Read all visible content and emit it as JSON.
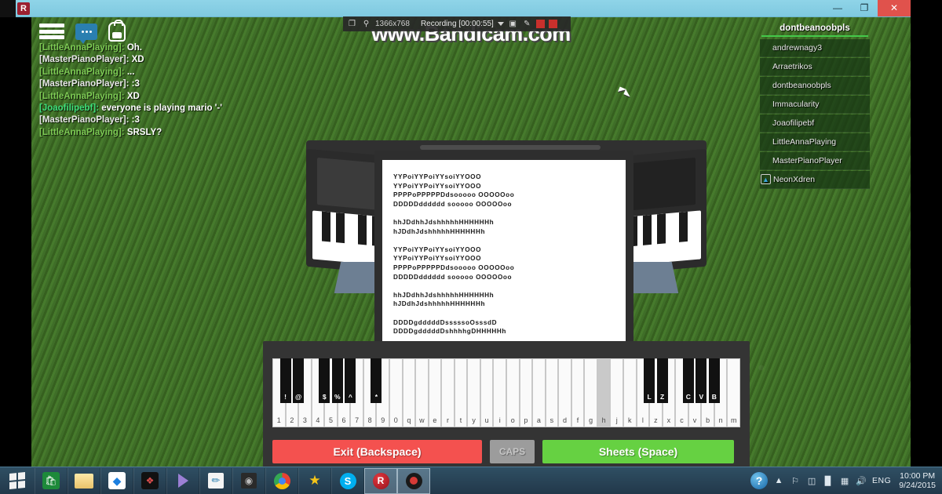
{
  "window": {
    "title": "ROBLOX",
    "minimize_label": "—",
    "maximize_label": "❐",
    "close_label": "✕"
  },
  "bandicam": {
    "watermark": "www.Bandicam.com",
    "resolution": "1366x768",
    "status": "Recording [00:00:55]",
    "window_icon": "window-capture-icon",
    "zoom_icon": "magnifier-icon",
    "dropdown_icon": "chevron-down-icon",
    "camera_icon": "camera-icon",
    "pen_icon": "pen-icon",
    "pause_icon": "pause-record-icon",
    "stop_icon": "stop-record-icon"
  },
  "game_ui": {
    "menu_icon": "hamburger-menu-icon",
    "chat_icon": "chat-bubble-icon",
    "backpack_icon": "backpack-icon"
  },
  "chat": {
    "lines": [
      {
        "name": "[LittleAnnaPlaying]:",
        "message": "Oh.",
        "color": "#7ecb55"
      },
      {
        "name": "[MasterPianoPlayer]:",
        "message": "XD",
        "color": "#e8e8e8"
      },
      {
        "name": "[LittleAnnaPlaying]:",
        "message": "...",
        "color": "#7ecb55"
      },
      {
        "name": "[MasterPianoPlayer]:",
        "message": ":3",
        "color": "#e8e8e8"
      },
      {
        "name": "[LittleAnnaPlaying]:",
        "message": "XD",
        "color": "#7ecb55"
      },
      {
        "name": "[Joaofilipebf]:",
        "message": "everyone is playing mario '-'",
        "color": "#3fe07a"
      },
      {
        "name": "[MasterPianoPlayer]:",
        "message": ":3",
        "color": "#e8e8e8"
      },
      {
        "name": "[LittleAnnaPlaying]:",
        "message": "SRSLY?",
        "color": "#7ecb55"
      }
    ]
  },
  "playerlist": {
    "title": "dontbeanoobpls",
    "accent": "#44c94a",
    "players": [
      {
        "name": "andrewnagy3",
        "badge": false
      },
      {
        "name": "Arraetrikos",
        "badge": false
      },
      {
        "name": "dontbeanoobpls",
        "badge": false
      },
      {
        "name": "Immacularity",
        "badge": false
      },
      {
        "name": "Joaofilipebf",
        "badge": false
      },
      {
        "name": "LittleAnnaPlaying",
        "badge": false
      },
      {
        "name": "MasterPianoPlayer",
        "badge": false
      },
      {
        "name": "NeonXdren",
        "badge": true,
        "badge_icon": "roblox-badge-icon"
      }
    ]
  },
  "sheet": {
    "text": "YYPoiYYPoiYYsoiYYOOO\nYYPoiYYPoiYYsoiYYOOO\nPPPPoPPPPPDdsooooo OOOOOoo\nDDDDDdddddd sooooo OOOOOoo\n\nhhJDdhhJdshhhhhHHHHHHh\nhJDdhJdshhhhhHHHHHHh\n\nYYPoiYYPoiYYsoiYYOOO\nYYPoiYYPoiYYsoiYYOOO\nPPPPoPPPPPDdsooooo OOOOOoo\nDDDDDdddddd sooooo OOOOOoo\n\nhhJDdhhJdshhhhhHHHHHHh\nhJDdhJdshhhhhHHHHHHh\n\nDDDDgdddddDsssssoOsssdD\nDDDDgdddddDshhhhgDHHHHHh\n\nhhJDdhhJdshhhhhHHHHHHh\nhJDdhJdshhhhhHHHHHHh"
  },
  "keyboard": {
    "white_keys": [
      "1",
      "2",
      "3",
      "4",
      "5",
      "6",
      "7",
      "8",
      "9",
      "0",
      "q",
      "w",
      "e",
      "r",
      "t",
      "y",
      "u",
      "i",
      "o",
      "p",
      "a",
      "s",
      "d",
      "f",
      "g",
      "h",
      "j",
      "k",
      "l",
      "z",
      "x",
      "c",
      "v",
      "b",
      "n",
      "m"
    ],
    "highlighted_key": "h",
    "black_keys": [
      "!",
      "@",
      "$",
      "%",
      "^",
      "*",
      "L",
      "Z",
      "C",
      "V",
      "B"
    ],
    "buttons": {
      "exit": "Exit (Backspace)",
      "caps": "CAPS",
      "sheets": "Sheets (Space)"
    },
    "colors": {
      "exit": "#f4514f",
      "caps": "#9c9c9c",
      "sheets": "#66d142"
    }
  },
  "taskbar": {
    "start_icon": "windows-start-icon",
    "items": [
      {
        "icon": "store-icon",
        "active": false
      },
      {
        "icon": "file-explorer-icon",
        "active": false
      },
      {
        "icon": "dropbox-icon",
        "active": false
      },
      {
        "icon": "puzzle-app-icon",
        "active": false
      },
      {
        "icon": "media-player-icon",
        "active": false
      },
      {
        "icon": "paint-net-icon",
        "active": false
      },
      {
        "icon": "video-editor-icon",
        "active": false
      },
      {
        "icon": "chrome-icon",
        "active": false
      },
      {
        "icon": "star-app-icon",
        "active": false
      },
      {
        "icon": "skype-icon",
        "active": false
      },
      {
        "icon": "roblox-icon",
        "active": true
      },
      {
        "icon": "bandicam-icon",
        "active": true
      }
    ],
    "tray": {
      "help_icon": "help-circle-icon",
      "show_hidden_icon": "chevron-up-icon",
      "flag_icon": "action-center-flag-icon",
      "battery_icon": "battery-icon",
      "network_icon": "network-signal-icon",
      "windows_icon": "windows-tray-icon",
      "volume_icon": "speaker-icon",
      "language": "ENG",
      "time": "10:00 PM",
      "date": "9/24/2015"
    }
  }
}
